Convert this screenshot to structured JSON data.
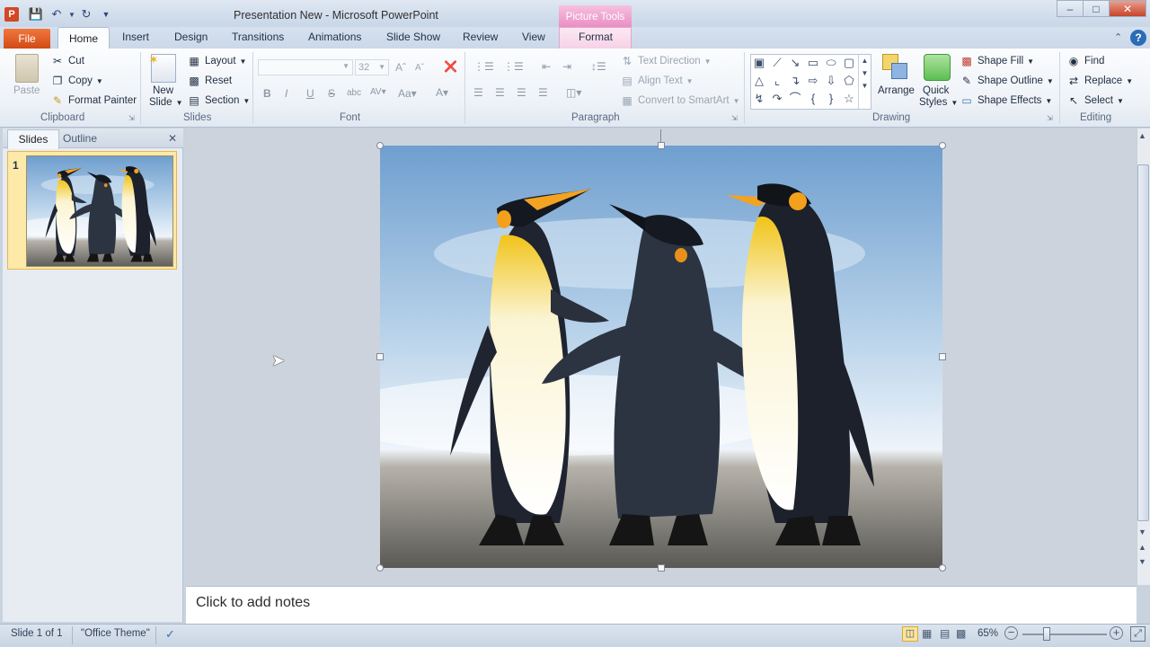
{
  "window": {
    "title": "Presentation New  -  Microsoft PowerPoint",
    "context_group": "Picture Tools",
    "context_tab": "Format",
    "controls": [
      "–",
      "□",
      "✕"
    ]
  },
  "qat": {
    "app_icon": "P"
  },
  "tabs": {
    "file": "File",
    "home": "Home",
    "insert": "Insert",
    "design": "Design",
    "transitions": "Transitions",
    "animations": "Animations",
    "slideshow": "Slide Show",
    "review": "Review",
    "view": "View",
    "format": "Format"
  },
  "ribbon": {
    "clipboard": {
      "label": "Clipboard",
      "paste": "Paste",
      "cut": "Cut",
      "copy": "Copy",
      "format_painter": "Format Painter"
    },
    "slides": {
      "label": "Slides",
      "new_slide_1": "New",
      "new_slide_2": "Slide",
      "layout": "Layout",
      "reset": "Reset",
      "section": "Section"
    },
    "font": {
      "label": "Font",
      "font_name": "",
      "font_size": "32"
    },
    "paragraph": {
      "label": "Paragraph",
      "text_direction": "Text Direction",
      "align_text": "Align Text",
      "convert_smartart": "Convert to SmartArt"
    },
    "drawing": {
      "label": "Drawing",
      "arrange": "Arrange",
      "quick_styles_1": "Quick",
      "quick_styles_2": "Styles",
      "shape_fill": "Shape Fill",
      "shape_outline": "Shape Outline",
      "shape_effects": "Shape Effects"
    },
    "editing": {
      "label": "Editing",
      "find": "Find",
      "replace": "Replace",
      "select": "Select"
    }
  },
  "left_pane": {
    "tab_slides": "Slides",
    "tab_outline": "Outline",
    "slide_number": "1"
  },
  "notes": {
    "placeholder": "Click to add notes"
  },
  "status": {
    "slide_info": "Slide 1 of 1",
    "theme": "\"Office Theme\"",
    "zoom": "65%"
  },
  "colors": {
    "file_tab": "#d9531e",
    "context_tab": "#e98dc3",
    "accent": "#2b579a"
  }
}
